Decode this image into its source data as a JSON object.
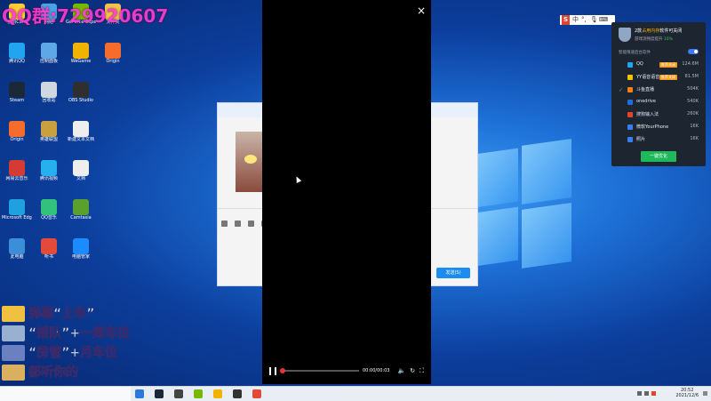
{
  "watermark": "QQ群:729920607",
  "desktop_icons": [
    {
      "label": "企鹅Cam",
      "color": "#ffcc33"
    },
    {
      "label": "腾讯QQ",
      "color": "#22a5f1"
    },
    {
      "label": "Steam",
      "color": "#1b2838"
    },
    {
      "label": "Origin",
      "color": "#f56c2d"
    },
    {
      "label": "网易云音乐",
      "color": "#d43c33"
    },
    {
      "label": "Microsoft Edge",
      "color": "#1fa0e0"
    },
    {
      "label": "此电脑",
      "color": "#3a8fd8"
    },
    {
      "label": "网络",
      "color": "#4aa2e6"
    },
    {
      "label": "控制面板",
      "color": "#5fa8e8"
    },
    {
      "label": "回收站",
      "color": "#cfd8e0"
    },
    {
      "label": "英雄联盟",
      "color": "#c8a040"
    },
    {
      "label": "腾讯视频",
      "color": "#26b0f0"
    },
    {
      "label": "QQ音乐",
      "color": "#31c27c"
    },
    {
      "label": "听书",
      "color": "#e34a3a"
    },
    {
      "label": "GeForce Experience",
      "color": "#76b900"
    },
    {
      "label": "WeGame",
      "color": "#f0b400"
    },
    {
      "label": "OBS Studio",
      "color": "#302e31"
    },
    {
      "label": "新建文本文档",
      "color": "#eeeeee"
    },
    {
      "label": "文档",
      "color": "#eeeeee"
    },
    {
      "label": "Camtasia",
      "color": "#5aa02c"
    },
    {
      "label": "电脑管家",
      "color": "#1a8cff"
    },
    {
      "label": "文件夹",
      "color": "#f2c14e"
    },
    {
      "label": "Origin",
      "color": "#f56c2d"
    }
  ],
  "chat_window": {
    "send_label": "发送(S)",
    "icons": [
      "smile-icon",
      "image-icon",
      "scissors-icon",
      "folder-icon"
    ]
  },
  "video_player": {
    "close_glyph": "×",
    "time_current": "00:00",
    "time_total": "00:03",
    "progress": 0
  },
  "ime_bar": {
    "logo": "S",
    "mode": "中"
  },
  "optimizer_panel": {
    "title_prefix": "2款",
    "title_highlight": "占用内存",
    "title_suffix": "软件可关闭",
    "subtitle": "游戏流畅度提升",
    "percent": "10%",
    "option_label": "智能限速后台软件",
    "toggle_on": true,
    "processes": [
      {
        "name": "QQ",
        "tag": "推荐关闭",
        "mem": "124.6M",
        "checked": false,
        "color": "#22a5f1"
      },
      {
        "name": "YY语音语音",
        "tag": "推荐关闭",
        "mem": "81.5M",
        "checked": false,
        "color": "#f5c400"
      },
      {
        "name": "斗鱼直播",
        "tag": "",
        "mem": "504K",
        "checked": true,
        "color": "#f2801c"
      },
      {
        "name": "onedrive",
        "tag": "",
        "mem": "540K",
        "checked": false,
        "color": "#1e6fd9"
      },
      {
        "name": "搜狗输入法",
        "tag": "",
        "mem": "260K",
        "checked": false,
        "color": "#e2442f"
      },
      {
        "name": "微软YourPhone",
        "tag": "",
        "mem": "16K",
        "checked": false,
        "color": "#3a7df2"
      },
      {
        "name": "照片",
        "tag": "",
        "mem": "16K",
        "checked": false,
        "color": "#3a7df2"
      }
    ],
    "optimize_button": "一键优化"
  },
  "overlay_rows": [
    {
      "text": "弹幕“上车”",
      "color": "#f0c040"
    },
    {
      "text": "“插队”+一周车位",
      "color": "#9ab0d0"
    },
    {
      "text": "“房管”+月车位",
      "color": "#6a80c0"
    },
    {
      "text": "都听你的",
      "color": "#d8b060"
    }
  ],
  "taskbar": {
    "time": "20:52",
    "date": "2021/12/6",
    "apps": [
      "#2a7bd8",
      "#1b2838",
      "#444444",
      "#76b900",
      "#f0b400",
      "#333333",
      "#e34a3a"
    ]
  }
}
